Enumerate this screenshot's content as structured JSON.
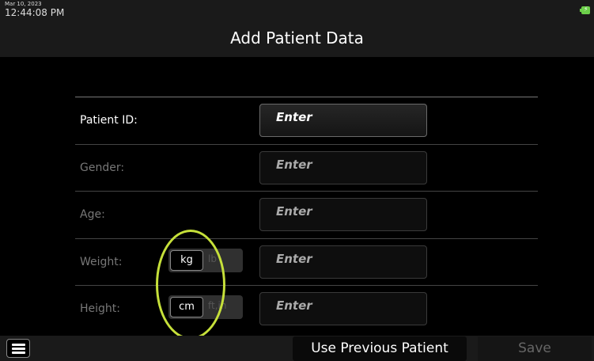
{
  "status": {
    "date": "Mar 10, 2023",
    "time": "12:44:08 PM",
    "battery_icon": "battery-charging-icon"
  },
  "header": {
    "title": "Add Patient Data"
  },
  "form": {
    "rows": [
      {
        "label": "Patient ID:",
        "field": "Enter"
      },
      {
        "label": "Gender:",
        "field": "Enter"
      },
      {
        "label": "Age:",
        "field": "Enter"
      },
      {
        "label": "Weight:",
        "field": "Enter",
        "unit_selected": "kg",
        "unit_other": "lb"
      },
      {
        "label": "Height:",
        "field": "Enter",
        "unit_selected": "cm",
        "unit_other": "ft,in"
      }
    ]
  },
  "footer": {
    "menu_icon": "hamburger-menu-icon",
    "use_previous_label": "Use Previous Patient",
    "save_label": "Save"
  },
  "colors": {
    "highlight": "#c6e03a",
    "battery": "#6ccf4a"
  }
}
